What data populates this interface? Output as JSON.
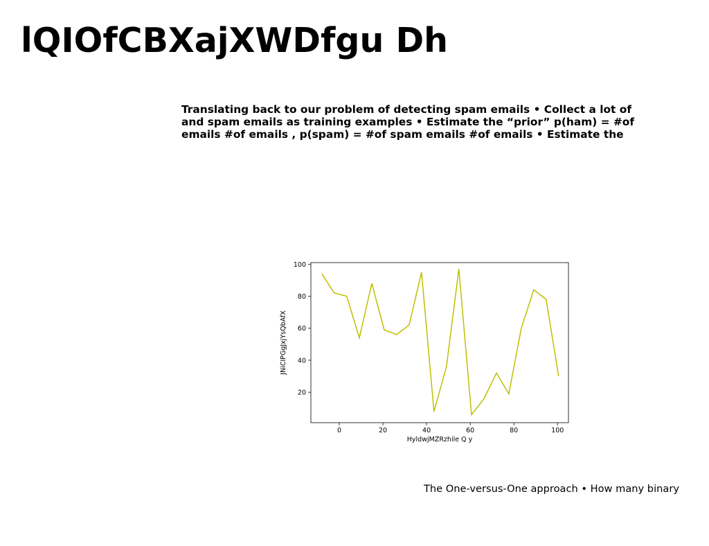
{
  "slide": {
    "title": "lQIOfCBXajXWDfgu Dh",
    "body_lines": [
      "Translating back to our problem of detecting spam emails • Collect a lot of",
      "and spam emails as training examples • Estimate the “prior” p(ham) = #of",
      "emails #of emails , p(spam) = #of spam emails #of emails • Estimate the"
    ],
    "footer": "The One-versus-One approach • How many binary"
  },
  "chart_data": {
    "type": "line",
    "xlabel": "HyldwjMZRzhile Q y",
    "ylabel": "JNiCIPGgJxjYsQbAfX",
    "xlim": [
      -13,
      105
    ],
    "ylim": [
      1,
      101
    ],
    "x_ticks": [
      0,
      20,
      40,
      60,
      80,
      100
    ],
    "y_ticks": [
      20,
      40,
      60,
      80,
      100
    ],
    "grid": false,
    "series": [
      {
        "color": "#bfbf00",
        "x": [
          -8,
          -2.3,
          3.4,
          9.2,
          14.9,
          20.6,
          26.3,
          32,
          37.7,
          43.4,
          49.1,
          54.8,
          60.6,
          66.3,
          72,
          77.7,
          83.4,
          89.1,
          94.8,
          100.5
        ],
        "y": [
          94,
          82,
          80,
          54,
          88,
          59,
          56,
          62,
          95,
          8,
          36,
          97,
          6,
          16,
          32,
          19,
          60,
          84,
          78,
          30
        ]
      }
    ]
  }
}
